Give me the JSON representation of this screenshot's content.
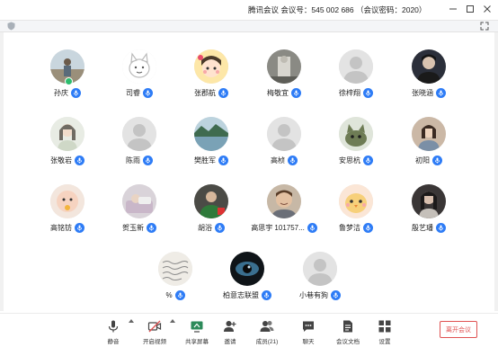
{
  "window": {
    "title": "腾讯会议 会议号：545 002 686 （会议密码：2020）"
  },
  "participants": [
    {
      "name": "孙庆",
      "avatar": "photo-outdoor",
      "host": true
    },
    {
      "name": "司睿",
      "avatar": "cartoon-cat"
    },
    {
      "name": "张郡航",
      "avatar": "cartoon-girl"
    },
    {
      "name": "梅敬宜",
      "avatar": "photo-statue"
    },
    {
      "name": "徐梓翔",
      "avatar": "default"
    },
    {
      "name": "张晓涵",
      "avatar": "photo-person-dark"
    },
    {
      "name": "张敬岩",
      "avatar": "photo-girl-painting"
    },
    {
      "name": "陈雨",
      "avatar": "default"
    },
    {
      "name": "樊胜军",
      "avatar": "photo-lake"
    },
    {
      "name": "高桢",
      "avatar": "default"
    },
    {
      "name": "安思杭",
      "avatar": "photo-cat"
    },
    {
      "name": "初阳",
      "avatar": "photo-person-indoor"
    },
    {
      "name": "高铭钫",
      "avatar": "photo-baby"
    },
    {
      "name": "贺玉新",
      "avatar": "photo-bed"
    },
    {
      "name": "胡浴",
      "avatar": "photo-green-person"
    },
    {
      "name": "高思宇 101757...",
      "avatar": "photo-man-smiling"
    },
    {
      "name": "鲁梦洁",
      "avatar": "cartoon-chick"
    },
    {
      "name": "殷艺璠",
      "avatar": "photo-person-dark2"
    },
    {
      "name": "%",
      "avatar": "photo-handwriting"
    },
    {
      "name": "柏意志联盟",
      "avatar": "photo-eye"
    },
    {
      "name": "小巷有狗",
      "avatar": "default"
    }
  ],
  "toolbar": {
    "mute": "静音",
    "video": "开启视频",
    "share": "共享屏幕",
    "invite": "邀请",
    "members": "成员(21)",
    "chat": "聊天",
    "docs": "会议文档",
    "settings": "设置",
    "leave": "离开会议"
  },
  "colors": {
    "mic_badge": "#2e7cf6",
    "leave_button": "#e05252",
    "host_indicator": "#2dbd6e"
  }
}
